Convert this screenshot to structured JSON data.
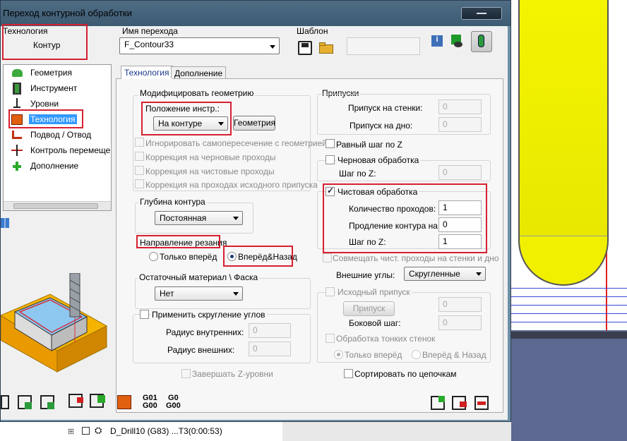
{
  "window": {
    "title": "Переход контурной обработки"
  },
  "header": {
    "technology_label": "Технология",
    "technology_value": "Контур",
    "operation_name_label": "Имя перехода",
    "operation_name_value": "F_Contour33",
    "template_label": "Шаблон"
  },
  "tree": {
    "items": [
      "Геометрия",
      "Инструмент",
      "Уровни",
      "Технология",
      "Подвод / Отвод",
      "Контроль перемеще",
      "Дополнение"
    ]
  },
  "tabs": [
    "Технология",
    "Дополнение"
  ],
  "modify_geometry": {
    "title": "Модифицировать геометрию",
    "tool_position_label": "Положение инстр.:",
    "tool_position_value": "На контуре",
    "geometry_button": "Геометрия",
    "options": [
      "Игнорировать самопересечение с геометрией",
      "Коррекция на черновые проходы",
      "Коррекция на чистовые проходы",
      "Коррекция на проходах исходного припуска"
    ]
  },
  "contour_depth": {
    "title": "Глубина контура",
    "value": "Постоянная"
  },
  "cut_direction": {
    "title": "Направление резания",
    "options": [
      "Только вперёд",
      "Вперёд&Назад"
    ],
    "selected": "Вперёд&Назад"
  },
  "rest_material": {
    "title": "Остаточный материал \\ Фаска",
    "value": "Нет"
  },
  "corner_round": {
    "label": "Применить скругление углов",
    "inner_label": "Радиус внутренних:",
    "inner_value": "0",
    "outer_label": "Радиус внешних:",
    "outer_value": "0"
  },
  "finish_z": "Завершать Z-уровни",
  "allowances": {
    "title": "Припуски",
    "wall_label": "Припуск на стенки:",
    "wall_value": "0",
    "floor_label": "Припуск на дно:",
    "floor_value": "0"
  },
  "equal_z_step": "Равный шаг по Z",
  "rough": {
    "label": "Черновая обработка",
    "z_step_label": "Шаг по Z:",
    "z_step_value": "0"
  },
  "finish": {
    "label": "Чистовая обработка",
    "passes_label": "Количество проходов:",
    "passes_value": "1",
    "extend_label": "Продление контура на:",
    "extend_value": "0",
    "z_step_label": "Шаг по Z:",
    "z_step_value": "1"
  },
  "combine_finish": "Совмещать чист. проходы на стенки и дно",
  "outer_corners": {
    "label": "Внешние углы:",
    "value": "Скругленные"
  },
  "initial_stock": {
    "label": "Исходный припуск",
    "button": "Припуск",
    "stock_value": "0",
    "side_step_label": "Боковой шаг:",
    "side_step_value": "0"
  },
  "thin_walls": {
    "label": "Обработка тонких стенок",
    "options": [
      "Только вперёд",
      "Вперёд & Назад"
    ]
  },
  "sort_chains": "Сортировать по цепочкам",
  "gcode_buttons": {
    "g01_g00_top": "G01",
    "g01_g00_bottom": "G00",
    "g0_g00_top": "G0",
    "g0_g00_bottom": "G00"
  },
  "background_tree_item": "D_Drill10 (G83) ...T3(0:00:53)",
  "colors": {
    "highlight_red": "#d62030",
    "tool_yellow": "#f0f000",
    "selection_blue": "#3399ff"
  }
}
